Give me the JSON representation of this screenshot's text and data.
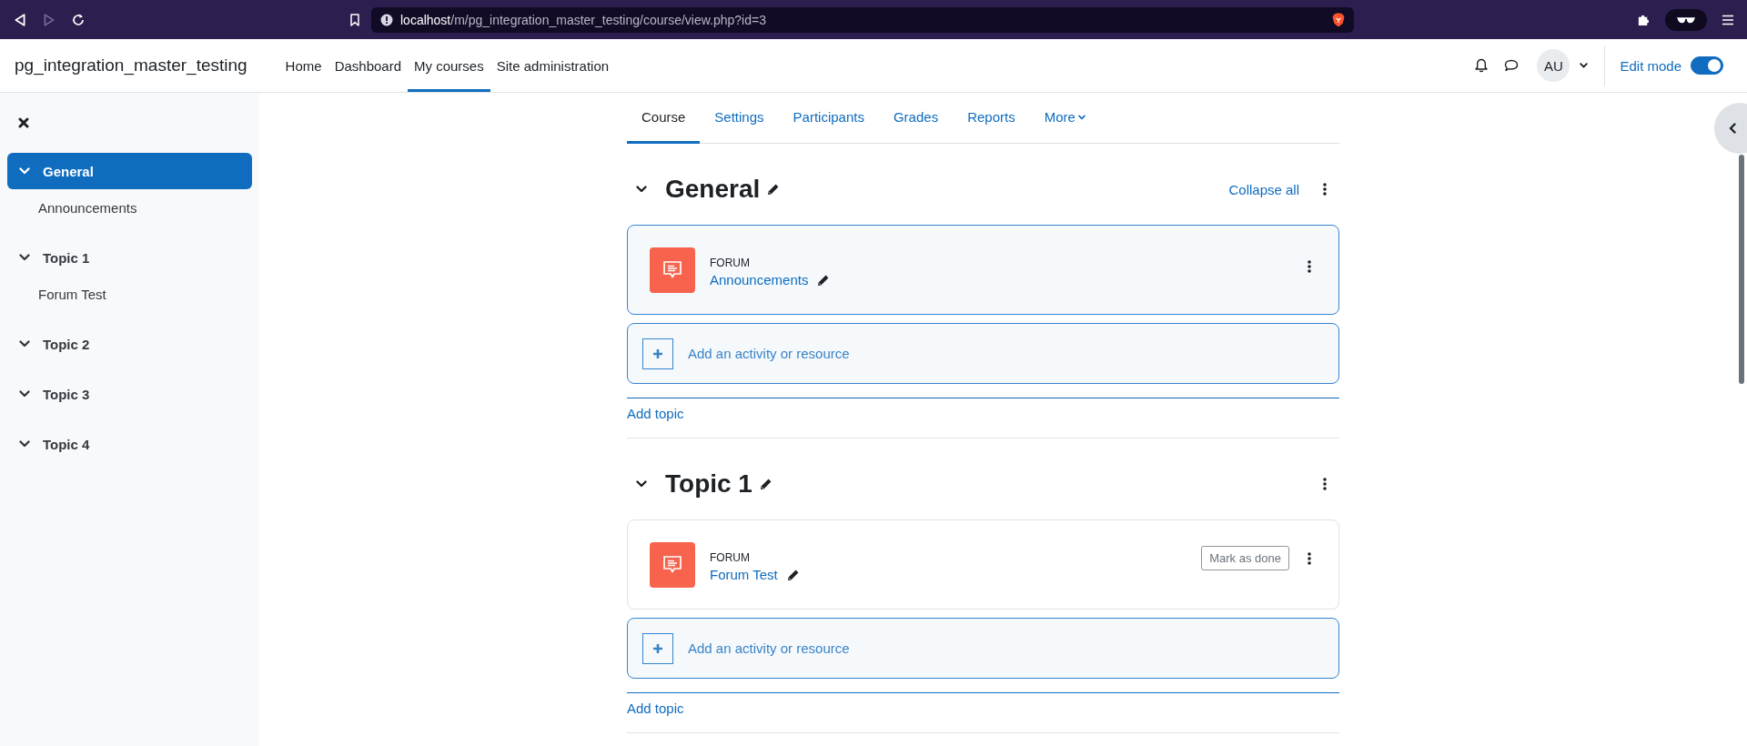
{
  "browser": {
    "url_host": "localhost",
    "url_path": "/m/pg_integration_master_testing/course/view.php?id=3"
  },
  "navbar": {
    "site_name": "pg_integration_master_testing",
    "links": [
      {
        "label": "Home",
        "selected": false
      },
      {
        "label": "Dashboard",
        "selected": false
      },
      {
        "label": "My courses",
        "selected": true
      },
      {
        "label": "Site administration",
        "selected": false
      }
    ],
    "avatar_initials": "AU",
    "edit_mode": {
      "label": "Edit mode",
      "on": true
    }
  },
  "sidebar": {
    "items": [
      {
        "label": "General",
        "selected": true,
        "expanded": true,
        "children": [
          {
            "label": "Announcements"
          }
        ]
      },
      {
        "label": "Topic 1",
        "selected": false,
        "expanded": true,
        "children": [
          {
            "label": "Forum Test"
          }
        ]
      },
      {
        "label": "Topic 2",
        "selected": false,
        "expanded": true
      },
      {
        "label": "Topic 3",
        "selected": false,
        "expanded": true
      },
      {
        "label": "Topic 4",
        "selected": false,
        "expanded": true
      }
    ]
  },
  "tabs": [
    {
      "label": "Course",
      "selected": true,
      "kind": "link"
    },
    {
      "label": "Settings",
      "selected": false,
      "kind": "link"
    },
    {
      "label": "Participants",
      "selected": false,
      "kind": "link"
    },
    {
      "label": "Grades",
      "selected": false,
      "kind": "link"
    },
    {
      "label": "Reports",
      "selected": false,
      "kind": "link"
    },
    {
      "label": "More",
      "selected": false,
      "kind": "dropdown"
    }
  ],
  "sections": [
    {
      "title": "General",
      "expanded": true,
      "collapse_all": "Collapse all",
      "activities": [
        {
          "type_label": "FORUM",
          "name": "Announcements",
          "highlighted": true
        }
      ],
      "add_activity": "Add an activity or resource",
      "add_topic": "Add topic"
    },
    {
      "title": "Topic 1",
      "expanded": true,
      "activities": [
        {
          "type_label": "FORUM",
          "name": "Forum Test",
          "highlighted": false,
          "completion_button": "Mark as done"
        }
      ],
      "add_activity": "Add an activity or resource",
      "add_topic": "Add topic"
    }
  ]
}
